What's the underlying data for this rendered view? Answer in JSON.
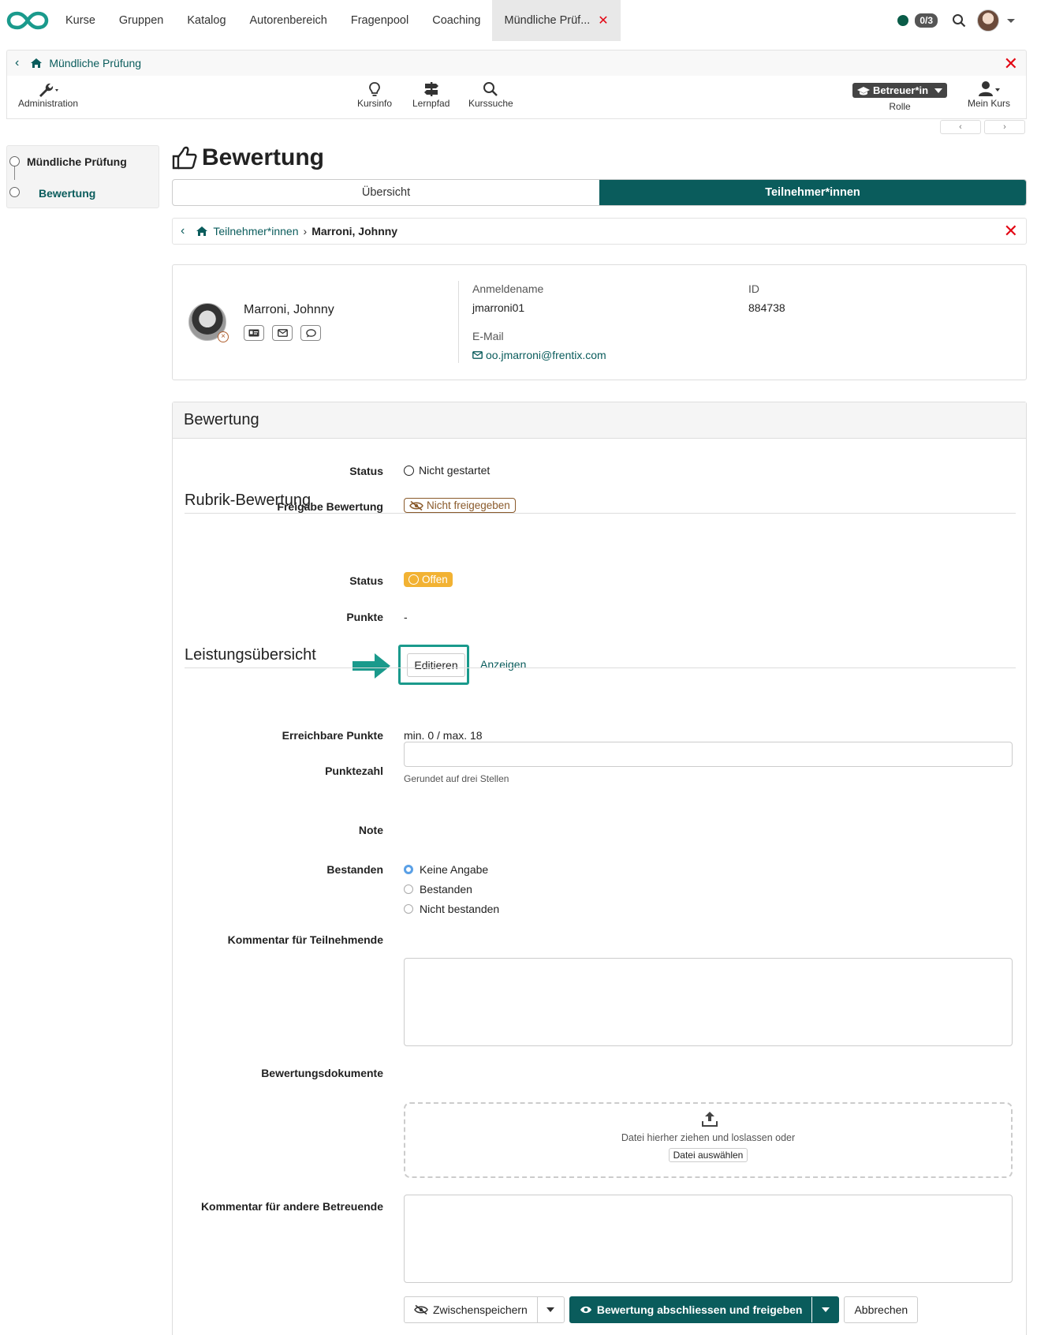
{
  "nav": {
    "items": [
      "Kurse",
      "Gruppen",
      "Katalog",
      "Autorenbereich",
      "Fragenpool",
      "Coaching"
    ],
    "active_tab": "Mündliche Prüf...",
    "counter": "0/3"
  },
  "course": {
    "title": "Mündliche Prüfung",
    "tools": {
      "administration": "Administration",
      "kursinfo": "Kursinfo",
      "lernpfad": "Lernpfad",
      "kurssuche": "Kurssuche",
      "role_value": "Betreuer*in",
      "role_label": "Rolle",
      "mein_kurs": "Mein Kurs"
    }
  },
  "sidebar": {
    "items": [
      "Mündliche Prüfung",
      "Bewertung"
    ]
  },
  "page": {
    "title": "Bewertung",
    "tabs": [
      "Übersicht",
      "Teilnehmer*innen"
    ],
    "breadcrumb": [
      "Teilnehmer*innen",
      "Marroni, Johnny"
    ]
  },
  "user": {
    "name": "Marroni, Johnny",
    "login_label": "Anmeldename",
    "login_value": "jmarroni01",
    "id_label": "ID",
    "id_value": "884738",
    "email_label": "E-Mail",
    "email_value": "oo.jmarroni@frentix.com"
  },
  "assessment": {
    "heading": "Bewertung",
    "status_label": "Status",
    "status_value": "Nicht gestartet",
    "release_label": "Freigabe Bewertung",
    "release_value": "Nicht freigegeben",
    "rubric_title": "Rubrik-Bewertung",
    "rubric_status_label": "Status",
    "rubric_status_value": "Offen",
    "points_label": "Punkte",
    "points_value": "-",
    "edit_label": "Editieren",
    "show_label": "Anzeigen",
    "perf_title": "Leistungsübersicht",
    "reachable_label": "Erreichbare Punkte",
    "reachable_value": "min. 0 / max. 18",
    "score_label": "Punktezahl",
    "score_hint": "Gerundet auf drei Stellen",
    "grade_label": "Note",
    "passed_label": "Bestanden",
    "passed_options": [
      "Keine Angabe",
      "Bestanden",
      "Nicht bestanden"
    ],
    "comment_label": "Kommentar für Teilnehmende",
    "docs_label": "Bewertungsdokumente",
    "drop_text": "Datei hierher ziehen und loslassen oder",
    "pick_label": "Datei auswählen",
    "coach_comment_label": "Kommentar für andere Betreuende",
    "save_label": "Zwischenspeichern",
    "finish_label": "Bewertung abschliessen und freigeben",
    "cancel_label": "Abbrechen"
  },
  "colors": {
    "primary": "#0a5c5c",
    "danger": "#e30613",
    "warning": "#f2b233",
    "highlight": "#1a9a8c"
  }
}
